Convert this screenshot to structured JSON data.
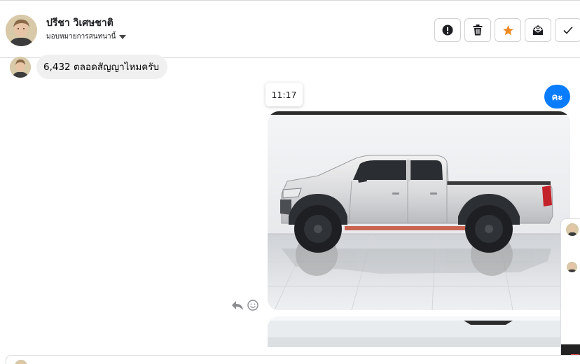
{
  "contact": {
    "name": "ปรีชา วิเศษชาติ",
    "assign_label": "มอบหมายการสนทนานี้"
  },
  "toolbar": {
    "buttons": [
      {
        "name": "alert-button",
        "icon": "exclamation-circle-icon"
      },
      {
        "name": "delete-button",
        "icon": "trash-icon"
      },
      {
        "name": "star-button",
        "icon": "star-icon",
        "color": "#f08a24"
      },
      {
        "name": "mark-unread-button",
        "icon": "envelope-icon"
      },
      {
        "name": "done-button",
        "icon": "check-icon"
      }
    ]
  },
  "messages": {
    "incoming_text": "6,432 ตลอดสัญญาไหมครับ",
    "timestamp_tooltip": "11:17",
    "outgoing_text": "คะ"
  },
  "colors": {
    "outgoing_bubble": "#0a7cff",
    "incoming_bubble": "#f0f0f0",
    "star": "#f08a24"
  }
}
